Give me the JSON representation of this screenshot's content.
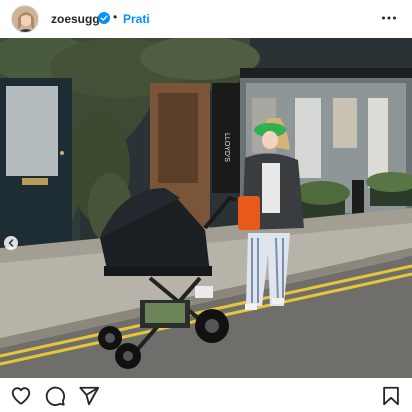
{
  "post": {
    "username": "zoesugg",
    "follow_label": "Prati",
    "separator": "•"
  },
  "icons": {
    "verified": "verified-badge-icon",
    "more": "more-options-icon",
    "prev": "chevron-left-icon",
    "like": "heart-icon",
    "comment": "comment-icon",
    "share": "send-icon",
    "save": "bookmark-icon"
  },
  "colors": {
    "accent": "#0095f6",
    "text": "#262626"
  },
  "photo": {
    "shop_sign": "LLOYD'S"
  }
}
